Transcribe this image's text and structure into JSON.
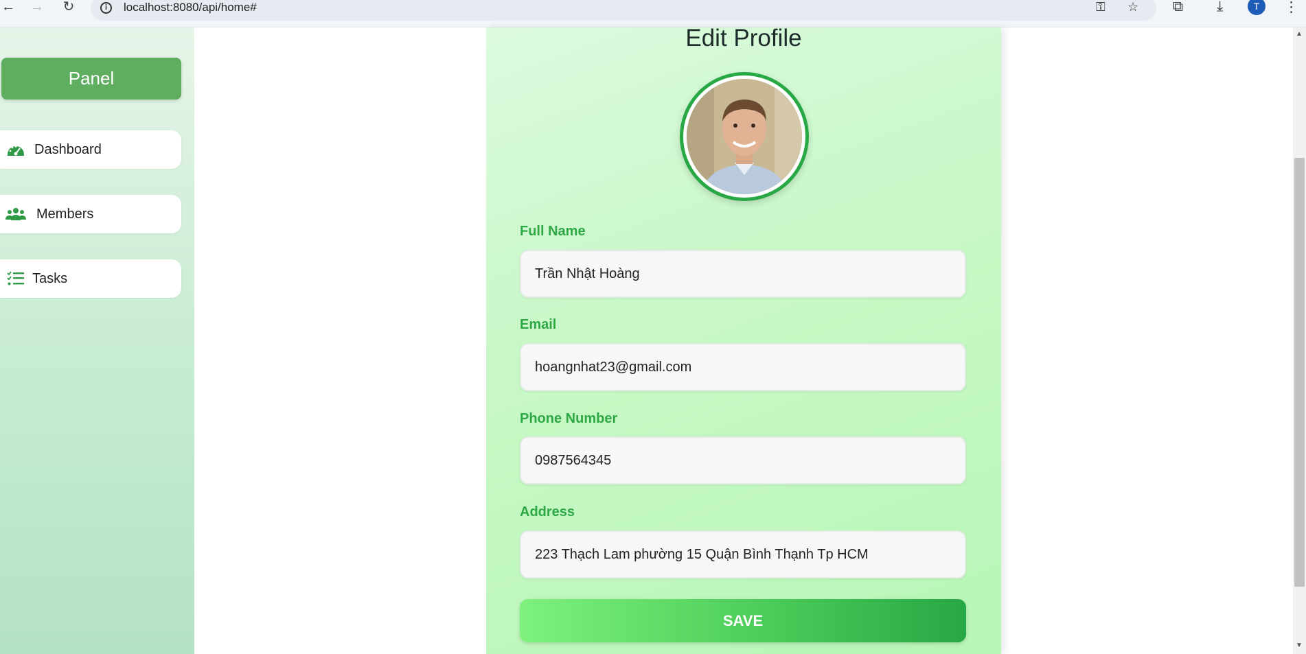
{
  "browser": {
    "url": "localhost:8080/api/home#",
    "profile_initial": "T"
  },
  "sidebar": {
    "panel_label": "Panel",
    "items": [
      {
        "label": "Dashboard",
        "icon": "gauge-icon"
      },
      {
        "label": "Members",
        "icon": "users-icon"
      },
      {
        "label": "Tasks",
        "icon": "checklist-icon"
      }
    ]
  },
  "profile": {
    "title": "Edit Profile",
    "fields": {
      "full_name": {
        "label": "Full Name",
        "value": "Trần Nhật Hoàng"
      },
      "email": {
        "label": "Email",
        "value": "hoangnhat23@gmail.com"
      },
      "phone": {
        "label": "Phone Number",
        "value": "0987564345"
      },
      "address": {
        "label": "Address",
        "value": "223 Thạch Lam phường 15 Quận Bình Thạnh Tp HCM"
      }
    },
    "save_label": "SAVE"
  },
  "colors": {
    "accent": "#28a745",
    "panel": "#5fae60",
    "label": "#2ea845"
  }
}
